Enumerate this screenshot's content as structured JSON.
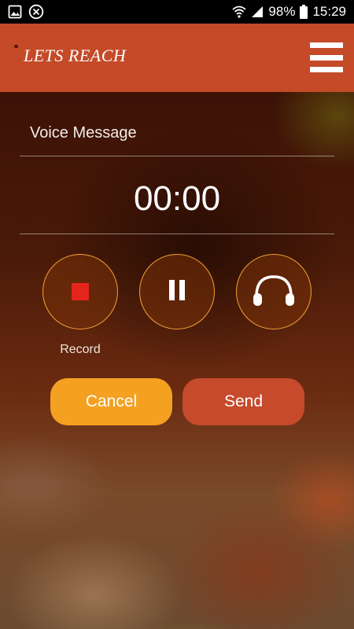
{
  "status_bar": {
    "battery": "98%",
    "time": "15:29",
    "icons": [
      "image-icon",
      "close-circle-icon",
      "wifi-icon",
      "signal-icon",
      "battery-icon"
    ]
  },
  "header": {
    "logo": "LETS REACH",
    "menu_icon": "hamburger-menu-icon",
    "color": "#c44a28"
  },
  "voice": {
    "title": "Voice Message",
    "timer": "00:00",
    "controls": [
      {
        "name": "record",
        "icon": "stop-square-icon",
        "label": "Record"
      },
      {
        "name": "pause",
        "icon": "pause-icon"
      },
      {
        "name": "play",
        "icon": "headphones-icon"
      }
    ]
  },
  "actions": {
    "cancel_label": "Cancel",
    "send_label": "Send",
    "cancel_color": "#f4a121",
    "send_color": "#c64a2c"
  }
}
